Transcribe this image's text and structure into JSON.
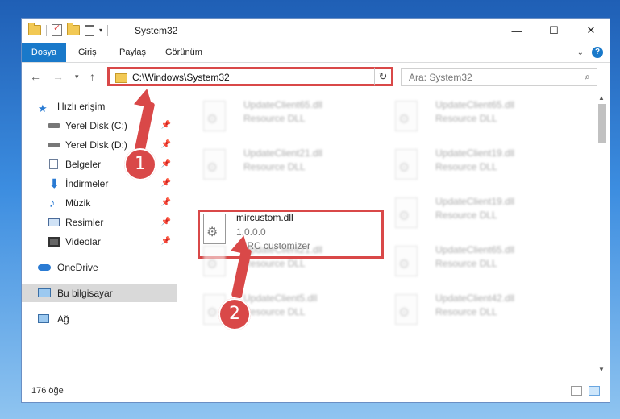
{
  "window": {
    "title": "System32",
    "controls": {
      "minimize": "—",
      "maximize": "☐",
      "close": "✕"
    }
  },
  "ribbon": {
    "tabs": [
      "Dosya",
      "Giriş",
      "Paylaş",
      "Görünüm"
    ],
    "help": "?"
  },
  "address": {
    "path": "C:\\Windows\\System32",
    "search_placeholder": "Ara: System32"
  },
  "sidebar": {
    "items": [
      {
        "label": "Hızlı erişim",
        "icon": "star-icon",
        "pinned": false
      },
      {
        "label": "Yerel Disk (C:)",
        "icon": "drive-icon",
        "pinned": true
      },
      {
        "label": "Yerel Disk (D:)",
        "icon": "drive-icon",
        "pinned": true
      },
      {
        "label": "Belgeler",
        "icon": "documents-icon",
        "pinned": true
      },
      {
        "label": "İndirmeler",
        "icon": "download-icon",
        "pinned": true
      },
      {
        "label": "Müzik",
        "icon": "music-icon",
        "pinned": true
      },
      {
        "label": "Resimler",
        "icon": "pictures-icon",
        "pinned": true
      },
      {
        "label": "Videolar",
        "icon": "video-icon",
        "pinned": true
      },
      {
        "label": "OneDrive",
        "icon": "cloud-icon",
        "pinned": false
      },
      {
        "label": "Bu bilgisayar",
        "icon": "computer-icon",
        "pinned": false,
        "selected": true
      },
      {
        "label": "Ağ",
        "icon": "network-icon",
        "pinned": false
      }
    ],
    "pin_glyph": "📌"
  },
  "files": {
    "highlighted": {
      "name": "mircustom.dll",
      "version": "1.0.0.0",
      "description": "mIRC customizer"
    },
    "background": [
      {
        "name": "UpdateClient65.dll",
        "description": "Resource DLL"
      },
      {
        "name": "UpdateClient65.dll",
        "description": "Resource DLL"
      },
      {
        "name": "UpdateClient21.dll",
        "description": "Resource DLL"
      },
      {
        "name": "UpdateClient19.dll",
        "description": "Resource DLL"
      },
      {
        "name": "UpdateClient19.dll",
        "description": "Resource DLL"
      },
      {
        "name": "UpdateClient21.dll",
        "description": "Resource DLL"
      },
      {
        "name": "UpdateClient65.dll",
        "description": "Resource DLL"
      },
      {
        "name": "UpdateClient5.dll",
        "description": "Resource DLL"
      },
      {
        "name": "UpdateClient42.dll",
        "description": "Resource DLL"
      }
    ]
  },
  "status": {
    "item_count": "176 öğe"
  },
  "annotations": {
    "badge1": "1",
    "badge2": "2",
    "color": "#d94848"
  }
}
